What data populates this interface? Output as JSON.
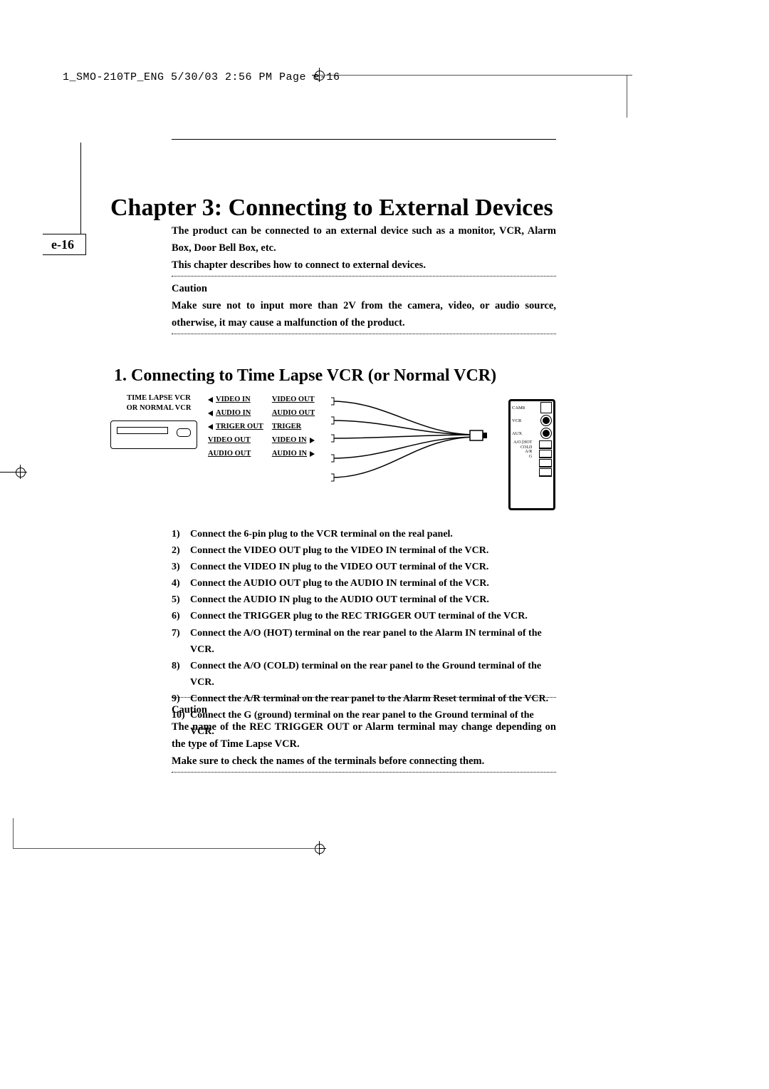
{
  "slug": "1_SMO-210TP_ENG  5/30/03  2:56 PM  Page e-16",
  "page_label": "e-16",
  "chapter_title": "Chapter 3: Connecting to External Devices",
  "intro": {
    "p1": "The product can be connected to an external device such as a monitor, VCR, Alarm Box, Door Bell Box, etc.",
    "p2": "This chapter describes how to connect to external devices.",
    "caution_label": "Caution",
    "caution_text": "Make sure not to input more than 2V from the camera, video, or audio source, otherwise, it may cause a malfunction of the product."
  },
  "section": {
    "title": "1. Connecting to Time Lapse VCR (or Normal VCR)"
  },
  "diagram": {
    "vcr_label_1": "TIME LAPSE VCR",
    "vcr_label_2": "OR NORMAL VCR",
    "signals": [
      {
        "left": "VIDEO IN",
        "right": "VIDEO OUT",
        "dir": "left"
      },
      {
        "left": "AUDIO IN",
        "right": "AUDIO OUT",
        "dir": "left"
      },
      {
        "left": "TRIGER OUT",
        "right": "TRIGER",
        "dir": "left"
      },
      {
        "left": "VIDEO OUT",
        "right": "VIDEO IN",
        "dir": "right"
      },
      {
        "left": "AUDIO OUT",
        "right": "AUDIO IN",
        "dir": "right"
      }
    ],
    "panel_labels": {
      "cam8": "CAM8",
      "vcr": "VCR",
      "aux": "AUX",
      "ao": "A/O",
      "hot": "HOT",
      "cold": "COLD",
      "ar": "A/R",
      "g": "G"
    }
  },
  "steps": [
    "Connect the 6-pin plug to the VCR terminal on the  real panel.",
    "Connect the VIDEO OUT plug to the VIDEO IN terminal of the VCR.",
    "Connect the VIDEO IN plug to the VIDEO OUT terminal of the VCR.",
    "Connect the AUDIO OUT plug to the AUDIO IN terminal of the VCR.",
    "Connect the AUDIO IN plug to the AUDIO OUT terminal of the VCR.",
    "Connect the TRIGGER plug to the REC TRIGGER OUT terminal of the VCR.",
    "Connect  the A/O (HOT) terminal on the rear panel to the Alarm IN terminal of the VCR.",
    "Connect the A/O (COLD) terminal on the rear panel to the Ground terminal of the VCR.",
    "Connect the A/R terminal on the rear panel to the Alarm Reset terminal of the VCR.",
    "Connect the G (ground) terminal on the rear panel to the Ground terminal of the VCR."
  ],
  "caution2": {
    "label": "Caution",
    "p1": "The name of the REC TRIGGER OUT or Alarm terminal may change depending on the type of Time Lapse VCR.",
    "p2": "Make sure to check the names of the terminals before connecting them."
  }
}
